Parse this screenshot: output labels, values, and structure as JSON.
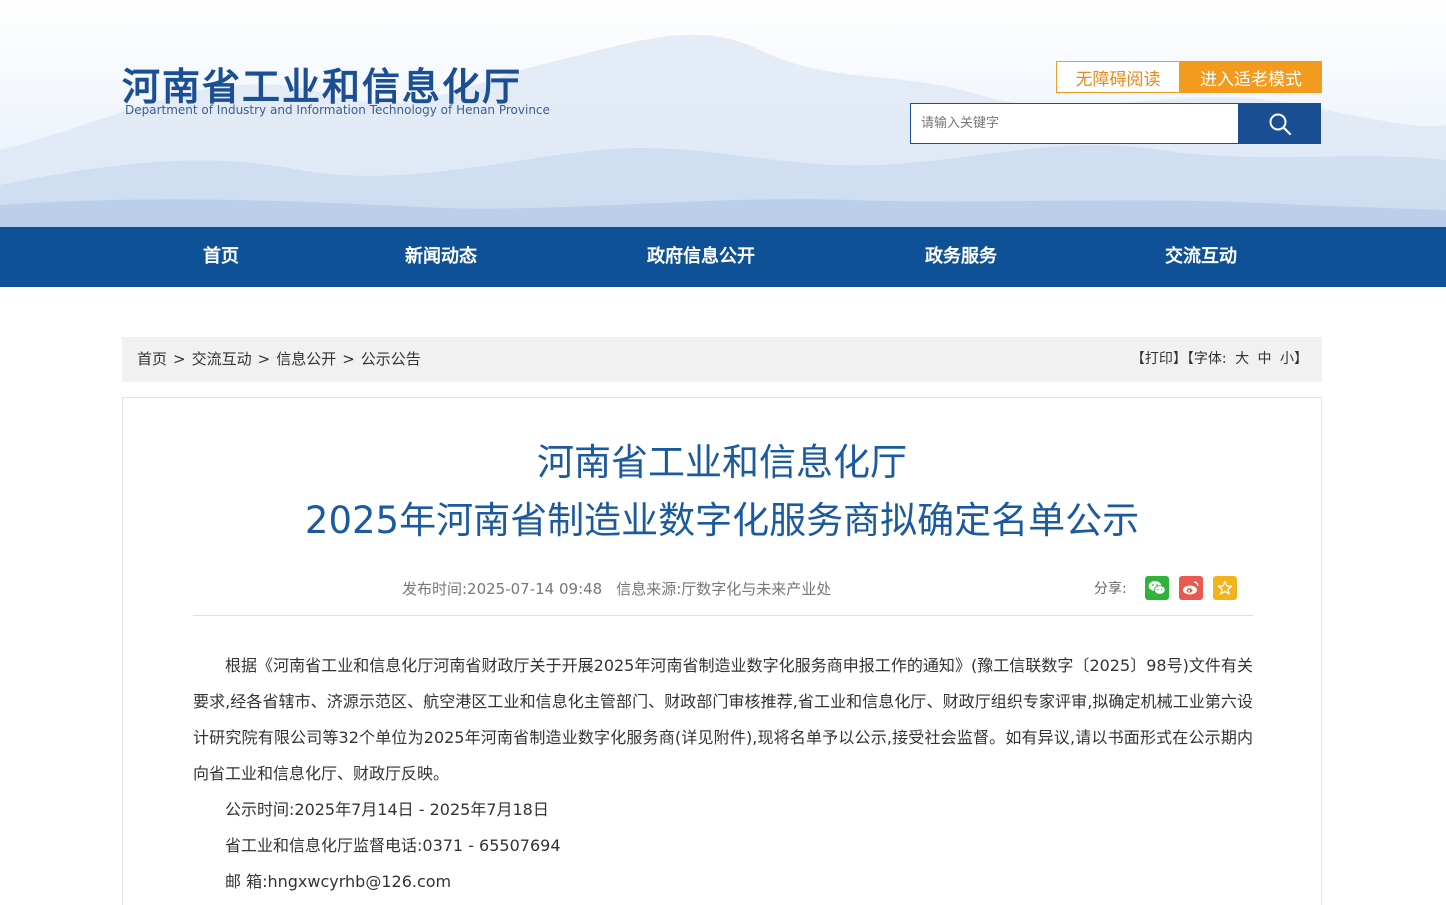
{
  "header": {
    "logo_cn": "河南省工业和信息化厅",
    "logo_en": "Department of Industry and Information Technology of Henan Province",
    "accessibility_label": "无障碍阅读",
    "elder_mode_label": "进入适老模式",
    "search": {
      "placeholder": "请输入关键字"
    }
  },
  "nav": {
    "items": [
      {
        "label": "首页"
      },
      {
        "label": "新闻动态"
      },
      {
        "label": "政府信息公开"
      },
      {
        "label": "政务服务"
      },
      {
        "label": "交流互动"
      }
    ]
  },
  "breadcrumb": {
    "items": [
      "首页",
      "交流互动",
      "信息公开",
      "公示公告"
    ],
    "separator": ">"
  },
  "tools": {
    "print": "【打印】",
    "font_label": "【字体:",
    "large": "大",
    "medium": "中",
    "small": "小",
    "close": "】"
  },
  "article": {
    "title_line1": "河南省工业和信息化厅",
    "title_line2": "2025年河南省制造业数字化服务商拟确定名单公示",
    "publish_time": "发布时间:2025-07-14 09:48",
    "source": "信息来源:厅数字化与未来产业处",
    "share_label": "分享:",
    "share_icons": [
      "wechat-icon",
      "weibo-icon",
      "favorite-icon"
    ],
    "paragraph": "根据《河南省工业和信息化厅河南省财政厅关于开展2025年河南省制造业数字化服务商申报工作的通知》(豫工信联数字〔2025〕98号)文件有关要求,经各省辖市、济源示范区、航空港区工业和信息化主管部门、财政部门审核推荐,省工业和信息化厅、财政厅组织专家评审,拟确定机械工业第六设计研究院有限公司等32个单位为2025年河南省制造业数字化服务商(详见附件),现将名单予以公示,接受社会监督。如有异议,请以书面形式在公示期内向省工业和信息化厅、财政厅反映。",
    "period": "公示时间:2025年7月14日 - 2025年7月18日",
    "phone": "省工业和信息化厅监督电话:0371 - 65507694",
    "email": "邮 箱:hngxwcyrhb@126.com"
  },
  "colors": {
    "brand_blue": "#0f5196",
    "title_blue": "#1b5a9e",
    "accent_orange": "#f39b1f",
    "wechat_green": "#2fb43b",
    "weibo_red": "#e8594f",
    "favorite_yellow": "#f3b31c"
  }
}
